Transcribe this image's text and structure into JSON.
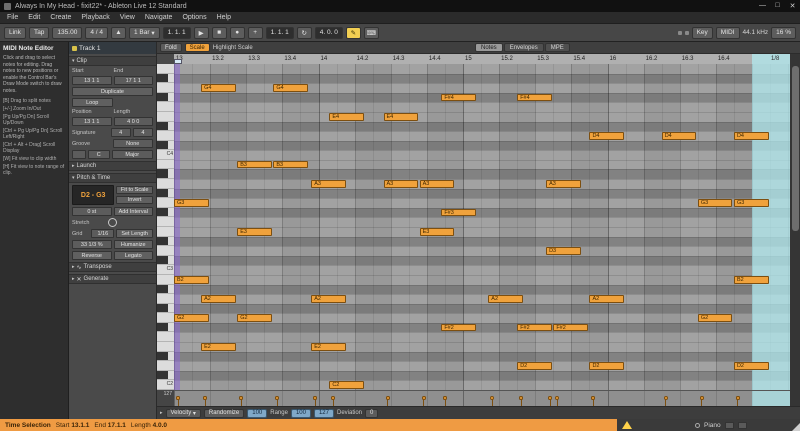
{
  "title_bar": {
    "title": "Always In My Head - fixit22* - Ableton Live 12 Standard"
  },
  "menu": [
    "File",
    "Edit",
    "Create",
    "Playback",
    "View",
    "Navigate",
    "Options",
    "Help"
  ],
  "transport": {
    "link": "Link",
    "tap": "Tap",
    "tempo": "135.00",
    "signature": "4 / 4",
    "quantize": "1 Bar",
    "position": "1. 1. 1",
    "loop_start": "1. 1. 1",
    "loop_length": "4. 0. 0",
    "key": "Key",
    "midi_label": "MIDI",
    "sample_rate": "44.1 kHz",
    "cpu": "16 %"
  },
  "info_panel": {
    "title": "MIDI Note Editor",
    "body": "Click and drag to select notes for editing. Drag notes to new positions or enable the Control Bar's Draw Mode switch to draw notes.",
    "shortcuts": [
      "[B] Drag to split notes",
      "[+/-] Zoom In/Out",
      "[Pg Up/Pg Dn] Scroll Up/Down",
      "[Ctrl + Pg Up/Pg Dn] Scroll Left/Right",
      "[Ctrl + Alt + Drag] Scroll Display",
      "[W] Fit view to clip width",
      "[H] Fit view to note range of clip."
    ]
  },
  "clip_panel": {
    "track": "Track 1",
    "clip_header": "Clip",
    "start_label": "Start",
    "end_label": "End",
    "start_value": "13 1 1",
    "end_value": "17 1 1",
    "duplicate": "Duplicate",
    "loop": "Loop",
    "position_label": "Position",
    "length_label": "Length",
    "position_value": "13 1 1",
    "length_value": "4 0 0",
    "signature_label": "Signature",
    "sig1": "4",
    "sig2": "4",
    "groove_label": "Groove",
    "groove_value": "None",
    "scale_root": "C",
    "scale_name": "Major",
    "launch": "Launch",
    "pitch_time": "Pitch & Time",
    "range": "D2 - G3",
    "fit": "Fit to Scale",
    "invert": "Invert",
    "interval": "0 st",
    "add_interval": "Add Interval",
    "stretch": "Stretch",
    "grid_label": "Grid",
    "grid_value": "1/16",
    "set_length": "Set Length",
    "humanize_pct": "33 1/3 %",
    "humanize": "Humanize",
    "reverse": "Reverse",
    "legato": "Legato",
    "transpose": "Transpose",
    "generate": "Generate"
  },
  "editor": {
    "fold": "Fold",
    "scale_btn": "Scale",
    "highlight": "Highlight Scale",
    "tabs": [
      "Notes",
      "Envelopes",
      "MPE"
    ],
    "active_tab": "Notes",
    "grid_value": "1/8",
    "ruler": [
      "13",
      "13.2",
      "13.3",
      "13.4",
      "14",
      "14.2",
      "14.3",
      "14.4",
      "15",
      "15.2",
      "15.3",
      "15.4",
      "16",
      "16.2",
      "16.3",
      "16.4"
    ]
  },
  "piano_roll": {
    "pitches": [
      "A4",
      "G#4",
      "G4",
      "F#4",
      "F4",
      "E4",
      "D#4",
      "D4",
      "C#4",
      "C4",
      "B3",
      "A#3",
      "A3",
      "G#3",
      "G3",
      "F#3",
      "F3",
      "E3",
      "D#3",
      "D3",
      "C#3",
      "C3",
      "B2",
      "A#2",
      "A2",
      "G#2",
      "G2",
      "F#2",
      "F2",
      "E2",
      "D#2",
      "D2",
      "C#2",
      "C2"
    ],
    "key_labels": [
      "C4",
      "C3",
      "C2"
    ],
    "beats_visible": 16,
    "notes": [
      {
        "pitch": "G4",
        "beat": 0.75,
        "len": 1
      },
      {
        "pitch": "G4",
        "beat": 2.75,
        "len": 1
      },
      {
        "pitch": "F#4",
        "beat": 7.4,
        "len": 1
      },
      {
        "pitch": "F#4",
        "beat": 9.5,
        "len": 1
      },
      {
        "pitch": "E4",
        "beat": 4.3,
        "len": 1
      },
      {
        "pitch": "E4",
        "beat": 5.8,
        "len": 1
      },
      {
        "pitch": "D4",
        "beat": 11.5,
        "len": 1
      },
      {
        "pitch": "D4",
        "beat": 13.5,
        "len": 1
      },
      {
        "pitch": "D4",
        "beat": 15.5,
        "len": 1
      },
      {
        "pitch": "B3",
        "beat": 1.75,
        "len": 1
      },
      {
        "pitch": "B3",
        "beat": 2.75,
        "len": 1
      },
      {
        "pitch": "A3",
        "beat": 3.8,
        "len": 1
      },
      {
        "pitch": "A3",
        "beat": 5.8,
        "len": 1
      },
      {
        "pitch": "A3",
        "beat": 6.8,
        "len": 1
      },
      {
        "pitch": "A3",
        "beat": 10.3,
        "len": 1
      },
      {
        "pitch": "G3",
        "beat": 0,
        "len": 1
      },
      {
        "pitch": "G3",
        "beat": 14.5,
        "len": 1
      },
      {
        "pitch": "G3",
        "beat": 15.5,
        "len": 1
      },
      {
        "pitch": "F#3",
        "beat": 7.4,
        "len": 1
      },
      {
        "pitch": "E3",
        "beat": 1.75,
        "len": 1
      },
      {
        "pitch": "E3",
        "beat": 6.8,
        "len": 1
      },
      {
        "pitch": "D3",
        "beat": 10.3,
        "len": 1
      },
      {
        "pitch": "B2",
        "beat": 0,
        "len": 1
      },
      {
        "pitch": "B2",
        "beat": 15.5,
        "len": 1
      },
      {
        "pitch": "A2",
        "beat": 0.75,
        "len": 1
      },
      {
        "pitch": "A2",
        "beat": 3.8,
        "len": 1
      },
      {
        "pitch": "A2",
        "beat": 8.7,
        "len": 1
      },
      {
        "pitch": "A2",
        "beat": 11.5,
        "len": 1
      },
      {
        "pitch": "G2",
        "beat": 0,
        "len": 1
      },
      {
        "pitch": "G2",
        "beat": 1.75,
        "len": 1
      },
      {
        "pitch": "G2",
        "beat": 14.5,
        "len": 1
      },
      {
        "pitch": "F#2",
        "beat": 7.4,
        "len": 1
      },
      {
        "pitch": "F#2",
        "beat": 9.5,
        "len": 1
      },
      {
        "pitch": "F#2",
        "beat": 10.5,
        "len": 1
      },
      {
        "pitch": "E2",
        "beat": 0.75,
        "len": 1
      },
      {
        "pitch": "E2",
        "beat": 3.8,
        "len": 1
      },
      {
        "pitch": "D2",
        "beat": 9.5,
        "len": 1
      },
      {
        "pitch": "D2",
        "beat": 11.5,
        "len": 1
      },
      {
        "pitch": "D2",
        "beat": 15.5,
        "len": 1
      },
      {
        "pitch": "C2",
        "beat": 4.3,
        "len": 1
      }
    ]
  },
  "velocity": {
    "lane_max": "127",
    "label": "Velocity",
    "randomize": "Randomize",
    "amount": "100",
    "range_label": "Range",
    "range_lo": "100",
    "range_hi": "127",
    "deviation_label": "Deviation",
    "deviation": "0"
  },
  "status_bar": {
    "left": "Time Selection",
    "start_label": "Start",
    "start_value": "13.1.1",
    "end_label": "End",
    "end_value": "17.1.1",
    "length_label": "Length",
    "length_value": "4.0.0",
    "device": "Piano"
  },
  "colors": {
    "note_fill": "#f0a23c",
    "note_border": "#7d4f10",
    "note_text": "#3d2600",
    "status_orange": "#ef9b43",
    "warning_yellow": "#ffd24a",
    "selection_purple": "rgba(140,100,220,0.5)",
    "offloop_cyan": "rgba(178,236,241,0.72)",
    "value_blue": "#7fa8c8"
  }
}
